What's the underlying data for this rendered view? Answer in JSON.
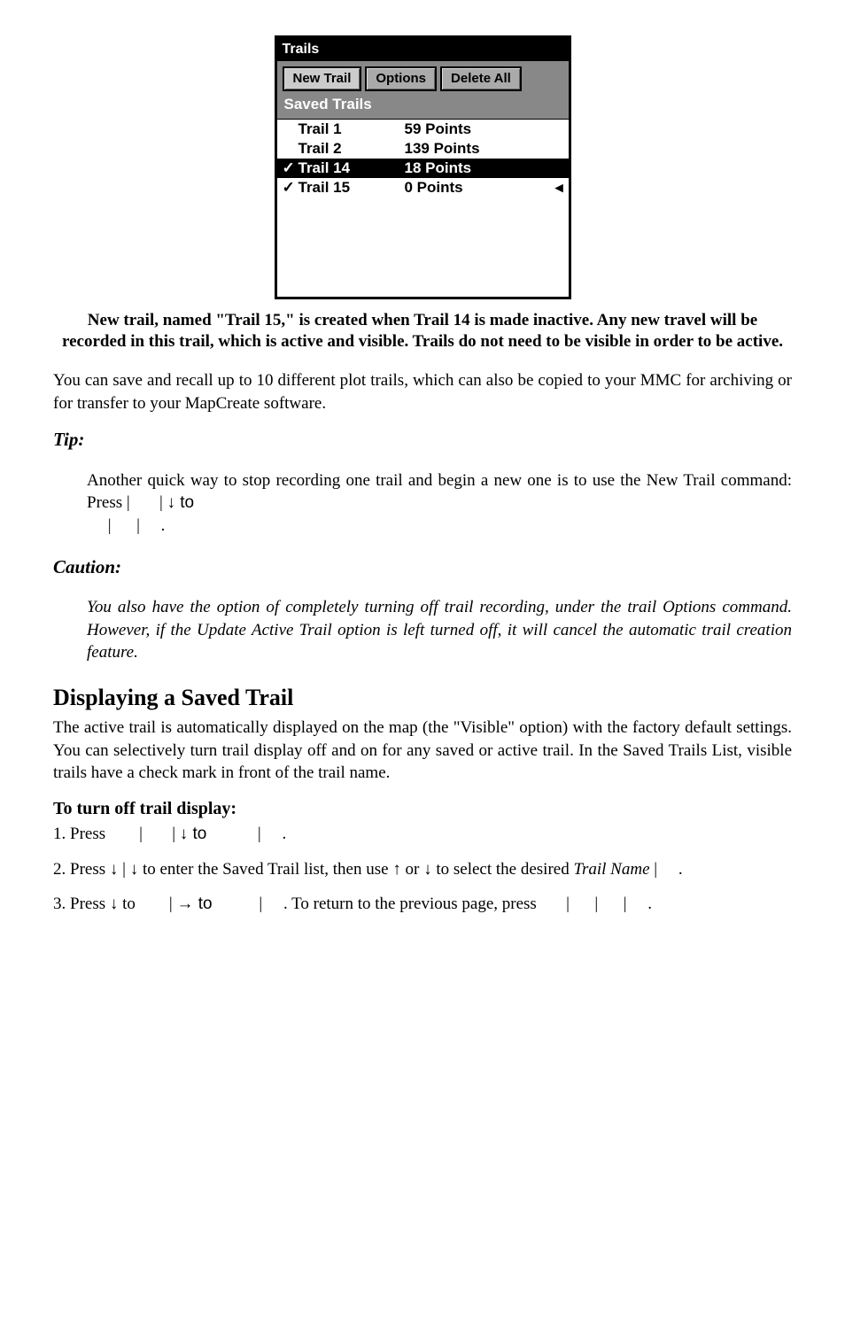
{
  "device": {
    "title": "Trails",
    "buttons": {
      "new_trail": "New Trail",
      "options": "Options",
      "delete_all": "Delete All"
    },
    "section_label": "Saved Trails",
    "rows": [
      {
        "check": "",
        "name": "Trail 1",
        "points": "59 Points",
        "cursor": ""
      },
      {
        "check": "",
        "name": "Trail 2",
        "points": "139 Points",
        "cursor": ""
      },
      {
        "check": "✓",
        "name": "Trail 14",
        "points": "18 Points",
        "cursor": ""
      },
      {
        "check": "✓",
        "name": "Trail 15",
        "points": "0 Points",
        "cursor": "◂"
      }
    ]
  },
  "caption": "New trail, named \"Trail 15,\" is created when Trail 14 is made inactive. Any new travel will be recorded in this trail, which is active and visible. Trails do not need to be visible in order to be active.",
  "para1": "You can save and recall up to 10 different plot trails, which can also be copied to your MMC for archiving or for transfer to your MapCreate software.",
  "tip_head": "Tip:",
  "tip_body_pre": "Another quick way to stop recording one trail and begin a new one is to use the New Trail command: Press ",
  "tip_sep1": "|",
  "tip_sep2": "|",
  "tip_to": "↓ to ",
  "tip_sep3": "|",
  "tip_sep4": "|",
  "tip_period": ".",
  "caution_head": "Caution:",
  "caution_body": "You also have the option of completely turning off trail recording, under the trail Options command. However, if the Update Active Trail option is left turned off, it will cancel the automatic trail creation feature.",
  "h2": "Displaying a Saved Trail",
  "para2": "The active trail is automatically displayed on the map (the \"Visible\" option) with the factory default settings. You can selectively turn trail display off and on for any saved or active trail. In the Saved Trails List, visible trails have a check mark in front of the trail name.",
  "sub_head": "To turn off trail display:",
  "step1_pre": "1. Press ",
  "step1_s1": "|",
  "step1_s2": "|",
  "step1_to": "↓ to ",
  "step1_s3": "|",
  "step1_end": ".",
  "step2_pre": "2. Press ↓",
  "step2_s1": "|",
  "step2_mid1": "↓ to enter the Saved Trail list, then use ↑ or ↓ to select the desired ",
  "step2_trail": "Trail Name",
  "step2_s2": "|",
  "step2_end": ".",
  "step3_pre": "3. Press ↓ to ",
  "step3_s1": "|",
  "step3_to": "→ to ",
  "step3_s2": "|",
  "step3_mid": ". To return to the previous page, press ",
  "step3_s3": "|",
  "step3_s4": "|",
  "step3_s5": "|",
  "step3_end": "."
}
